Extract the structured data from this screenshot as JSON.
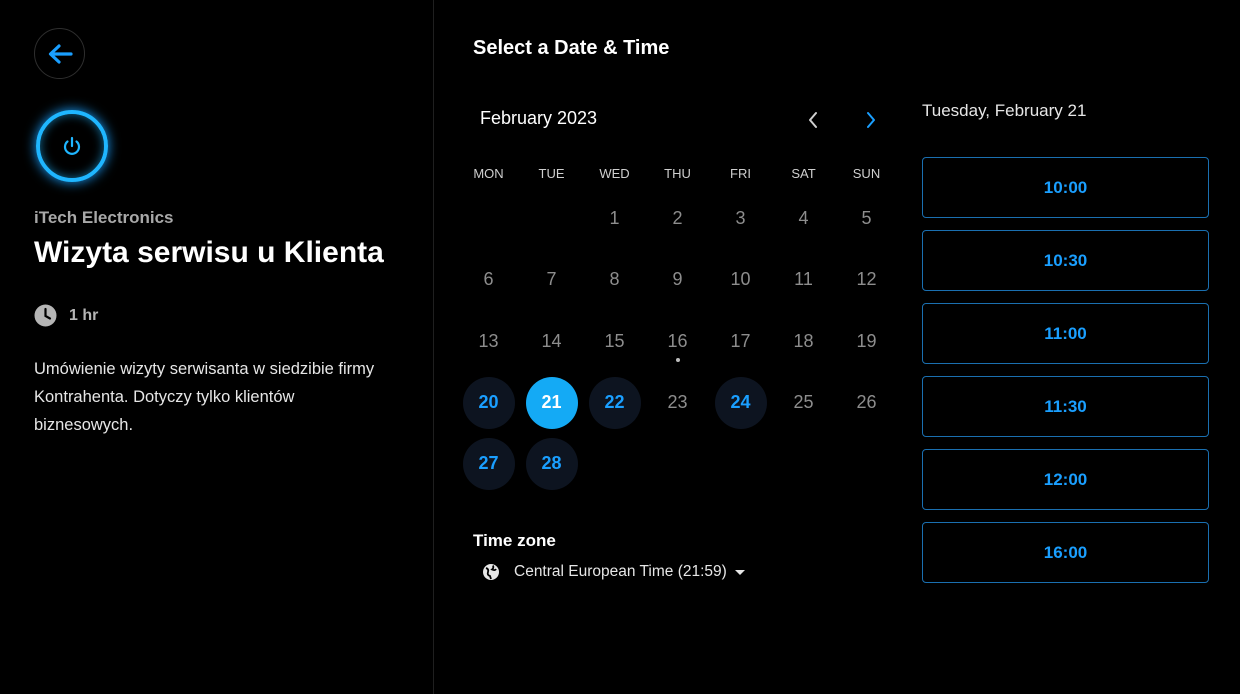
{
  "colors": {
    "accent": "#1a9fff",
    "selected_bg": "#14aaf5",
    "available_bg": "#0d1420",
    "slot_border": "#1a6fb0"
  },
  "left_panel": {
    "back_icon": "arrow-left-icon",
    "logo_icon": "power-icon",
    "company": "iTech Electronics",
    "event_title": "Wizyta serwisu u Klienta",
    "duration_icon": "clock-icon",
    "duration": "1 hr",
    "description": "Umówienie wizyty serwisanta w siedzibie firmy Kontrahenta. Dotyczy tylko klientów biznesowych."
  },
  "calendar": {
    "heading": "Select a Date & Time",
    "month": "February 2023",
    "prev_icon": "chevron-left-icon",
    "next_icon": "chevron-right-icon",
    "weekdays": [
      "MON",
      "TUE",
      "WED",
      "THU",
      "FRI",
      "SAT",
      "SUN"
    ],
    "leading_blanks": 2,
    "days": [
      {
        "n": "1",
        "state": "disabled"
      },
      {
        "n": "2",
        "state": "disabled"
      },
      {
        "n": "3",
        "state": "disabled"
      },
      {
        "n": "4",
        "state": "disabled"
      },
      {
        "n": "5",
        "state": "disabled"
      },
      {
        "n": "6",
        "state": "disabled"
      },
      {
        "n": "7",
        "state": "disabled"
      },
      {
        "n": "8",
        "state": "disabled"
      },
      {
        "n": "9",
        "state": "disabled"
      },
      {
        "n": "10",
        "state": "disabled"
      },
      {
        "n": "11",
        "state": "disabled"
      },
      {
        "n": "12",
        "state": "disabled"
      },
      {
        "n": "13",
        "state": "disabled"
      },
      {
        "n": "14",
        "state": "disabled"
      },
      {
        "n": "15",
        "state": "disabled"
      },
      {
        "n": "16",
        "state": "today"
      },
      {
        "n": "17",
        "state": "disabled"
      },
      {
        "n": "18",
        "state": "disabled"
      },
      {
        "n": "19",
        "state": "disabled"
      },
      {
        "n": "20",
        "state": "available"
      },
      {
        "n": "21",
        "state": "selected"
      },
      {
        "n": "22",
        "state": "available"
      },
      {
        "n": "23",
        "state": "disabled"
      },
      {
        "n": "24",
        "state": "available"
      },
      {
        "n": "25",
        "state": "disabled"
      },
      {
        "n": "26",
        "state": "disabled"
      },
      {
        "n": "27",
        "state": "available"
      },
      {
        "n": "28",
        "state": "available"
      }
    ]
  },
  "timezone": {
    "label": "Time zone",
    "globe_icon": "globe-icon",
    "value": "Central European Time (21:59)",
    "caret_icon": "caret-down-icon"
  },
  "times": {
    "date_label": "Tuesday, February 21",
    "slots": [
      "10:00",
      "10:30",
      "11:00",
      "11:30",
      "12:00",
      "16:00"
    ]
  }
}
